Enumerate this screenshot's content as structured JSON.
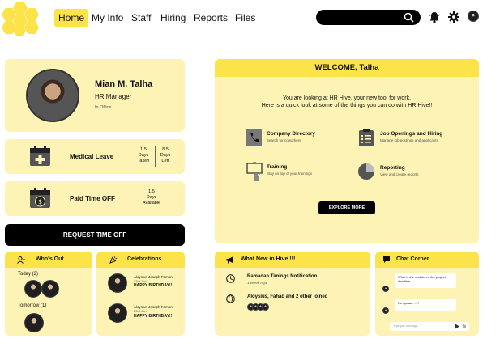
{
  "nav": {
    "items": [
      {
        "label": "Home",
        "active": true
      },
      {
        "label": "My Info",
        "active": false
      },
      {
        "label": "Staff",
        "active": false
      },
      {
        "label": "Hiring",
        "active": false
      },
      {
        "label": "Reports",
        "active": false
      },
      {
        "label": "Files",
        "active": false
      }
    ]
  },
  "profile": {
    "name": "Mian M. Talha",
    "title": "HR Manager",
    "status": "In Office"
  },
  "leave": {
    "medical": {
      "label": "Medical Leave",
      "taken_value": "1.5",
      "taken_unit1": "Days",
      "taken_unit2": "Taken",
      "left_value": "8.5",
      "left_unit1": "Days",
      "left_unit2": "Left"
    },
    "pto": {
      "label": "Paid Time OFF",
      "value": "1.5",
      "unit1": "Days",
      "unit2": "Available"
    },
    "request_button": "REQUEST TIME OFF"
  },
  "whos_out": {
    "title": "Who's Out",
    "today_label": "Today (2)",
    "tomorrow_label": "Tomorrow (1)"
  },
  "celebrations": {
    "title": "Celebrations",
    "items": [
      {
        "name": "Aloysius Joseph Famon",
        "date": "23rd Jun",
        "message": "HAPPY BIRTHDAY!!"
      },
      {
        "name": "Aloysius Joseph Famon",
        "date": "23rd Jun",
        "message": "HAPPY BIRTHDAY!!"
      }
    ]
  },
  "welcome": {
    "title": "WELCOME, Talha",
    "line1": "You are looking at HR Hive, your new tool for work.",
    "line2": "Here is a quick look at some of the things you can do with HR Hive!!",
    "features": [
      {
        "title": "Company Directory",
        "desc": "Search for coworkers",
        "icon": "phone-icon"
      },
      {
        "title": "Job Openings and Hiring",
        "desc": "Manage job postings and applicants",
        "icon": "clipboard-icon"
      },
      {
        "title": "Training",
        "desc": "Stay on top of your trainings",
        "icon": "training-board-icon"
      },
      {
        "title": "Reporting",
        "desc": "View and create reports",
        "icon": "pie-chart-icon"
      }
    ],
    "explore_button": "EXPLORE MORE"
  },
  "whats_new": {
    "title": "What New in Hive !!!",
    "items": [
      {
        "title": "Ramadan Timings Notification",
        "time": "1 Week Ago",
        "icon": "clock-icon"
      },
      {
        "title": "Aloysius, Fahad and 2 other joined",
        "time": "",
        "icon": "globe-icon"
      }
    ]
  },
  "chat": {
    "title": "Chat Corner",
    "messages": [
      {
        "text": "What is the update on the project deadline"
      },
      {
        "text": "No update.... ?"
      }
    ],
    "input_placeholder": "type your message"
  },
  "colors": {
    "accent": "#fde34a",
    "card_bg": "#fdf3b4",
    "dark": "#000000"
  }
}
